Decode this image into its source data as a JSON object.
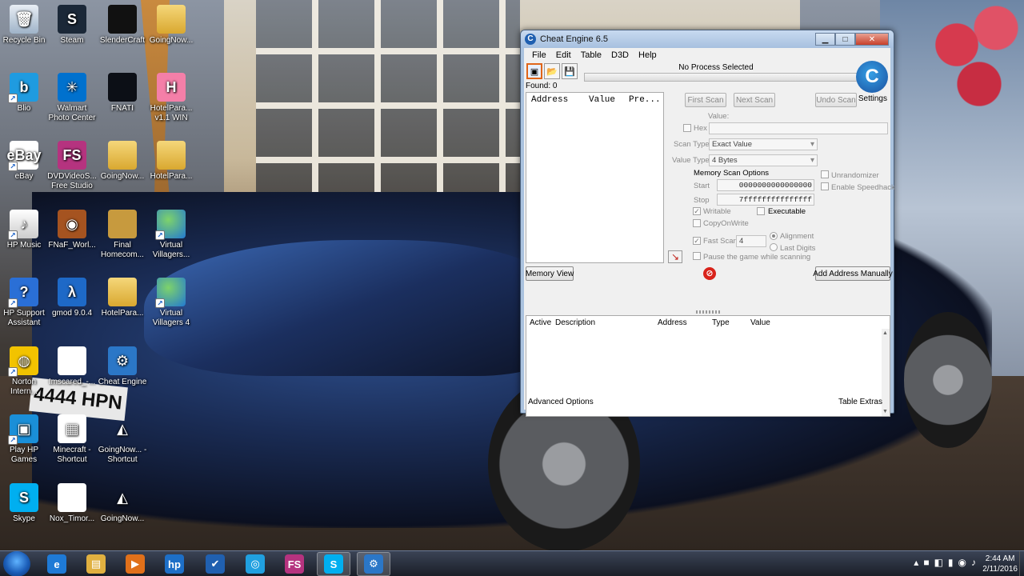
{
  "desktop": {
    "icons": [
      {
        "label": "Recycle Bin",
        "glyph": "🗑",
        "icon": "recycle-bin-icon"
      },
      {
        "label": "Steam",
        "glyph": "S",
        "icon": "steam-icon"
      },
      {
        "label": "SlenderCraft",
        "glyph": "",
        "icon": "slendercraft-icon"
      },
      {
        "label": "GoingNow...",
        "glyph": "",
        "icon": "folder-icon"
      },
      {
        "label": "Blio",
        "glyph": "b",
        "icon": "blio-icon"
      },
      {
        "label": "Walmart Photo Center",
        "glyph": "✳",
        "icon": "walmart-icon"
      },
      {
        "label": "FNATI",
        "glyph": "",
        "icon": "fnati-icon"
      },
      {
        "label": "HotelPara... v1.1 WIN",
        "glyph": "H",
        "icon": "hotel-icon"
      },
      {
        "label": "eBay",
        "glyph": "eBay",
        "icon": "ebay-icon"
      },
      {
        "label": "DVDVideoS... Free Studio",
        "glyph": "FS",
        "icon": "dvdvideosoft-icon"
      },
      {
        "label": "GoingNow...",
        "glyph": "",
        "icon": "folder-icon"
      },
      {
        "label": "HotelPara...",
        "glyph": "",
        "icon": "folder-icon"
      },
      {
        "label": "HP Music",
        "glyph": "♪",
        "icon": "hp-music-icon"
      },
      {
        "label": "FNaF_Worl...",
        "glyph": "◉",
        "icon": "fnaf-world-icon"
      },
      {
        "label": "Final Homecom...",
        "glyph": "",
        "icon": "final-homecoming-icon"
      },
      {
        "label": "Virtual Villagers...",
        "glyph": "",
        "icon": "globe-icon"
      },
      {
        "label": "HP Support Assistant",
        "glyph": "?",
        "icon": "hp-support-icon"
      },
      {
        "label": "gmod 9.0.4",
        "glyph": "λ",
        "icon": "gmod-icon"
      },
      {
        "label": "HotelPara...",
        "glyph": "",
        "icon": "folder-icon"
      },
      {
        "label": "Virtual Villagers 4",
        "glyph": "",
        "icon": "globe-icon"
      },
      {
        "label": "Norton Intern...",
        "glyph": "◍",
        "icon": "norton-icon"
      },
      {
        "label": "Imscared_-...",
        "glyph": "",
        "icon": "document-icon"
      },
      {
        "label": "Cheat Engine",
        "glyph": "⚙",
        "icon": "cheat-engine-icon"
      },
      {
        "label": "Play HP Games",
        "glyph": "▣",
        "icon": "play-hp-games-icon"
      },
      {
        "label": "Minecraft - Shortcut",
        "glyph": "▦",
        "icon": "minecraft-icon"
      },
      {
        "label": "GoingNow... - Shortcut",
        "glyph": "◭",
        "icon": "unity-icon"
      },
      {
        "label": "Skype",
        "glyph": "S",
        "icon": "skype-icon"
      },
      {
        "label": "Nox_Timor...",
        "glyph": "",
        "icon": "document-icon"
      },
      {
        "label": "GoingNow...",
        "glyph": "◭",
        "icon": "unity-icon"
      }
    ],
    "wallpaper_plate": "4444 HPN"
  },
  "ce": {
    "title": "Cheat Engine 6.5",
    "app_glyph": "C",
    "win_buttons": {
      "min": "▁",
      "max": "□",
      "close": "✕"
    },
    "menu": [
      "File",
      "Edit",
      "Table",
      "D3D",
      "Help"
    ],
    "toolbar_glyphs": {
      "process": "▣",
      "open": "📂",
      "save": "💾"
    },
    "process_label": "No Process Selected",
    "found": "Found: 0",
    "logo_glyph": "C",
    "settings": "Settings",
    "addr_headers": [
      "Address",
      "Value",
      "Pre..."
    ],
    "first_scan": "First Scan",
    "next_scan": "Next Scan",
    "undo_scan": "Undo Scan",
    "value_label": "Value:",
    "hex": "Hex",
    "scan_type_label": "Scan Type",
    "scan_type_value": "Exact Value",
    "value_type_label": "Value Type",
    "value_type_value": "4 Bytes",
    "mem_opts_label": "Memory Scan Options",
    "start_label": "Start",
    "start_value": "0000000000000000",
    "stop_label": "Stop",
    "stop_value": "7fffffffffffffff",
    "writable": "Writable",
    "executable": "Executable",
    "copyonwrite": "CopyOnWrite",
    "fast_scan": "Fast Scan",
    "fast_scan_value": "4",
    "alignment": "Alignment",
    "last_digits": "Last Digits",
    "pause_game": "Pause the game while scanning",
    "unrandomizer": "Unrandomizer",
    "enable_speedhack": "Enable Speedhack",
    "memory_view": "Memory View",
    "add_address": "Add Address Manually",
    "stop_glyph": "⊘",
    "pointer_glyph": "↘",
    "check_mark": "✓",
    "table_headers": [
      "Active",
      "Description",
      "Address",
      "Type",
      "Value"
    ],
    "scroll_up": "▲",
    "scroll_down": "▼",
    "advanced_options": "Advanced Options",
    "table_extras": "Table Extras"
  },
  "taskbar": {
    "apps": [
      {
        "glyph": "e",
        "icon": "internet-explorer-icon",
        "color": "#1e7ad6"
      },
      {
        "glyph": "▤",
        "icon": "file-explorer-icon",
        "color": "#e0b040"
      },
      {
        "glyph": "▶",
        "icon": "media-player-icon",
        "color": "#e0701a"
      },
      {
        "glyph": "hp",
        "icon": "hp-icon",
        "color": "#1d6fc7"
      },
      {
        "glyph": "✔",
        "icon": "task-icon",
        "color": "#2060b0"
      },
      {
        "glyph": "◎",
        "icon": "browser-icon",
        "color": "#20a0e0"
      },
      {
        "glyph": "FS",
        "icon": "dvdvideosoft-icon",
        "color": "#b5337f"
      },
      {
        "glyph": "S",
        "icon": "skype-icon",
        "color": "#00aff0"
      },
      {
        "glyph": "⚙",
        "icon": "cheat-engine-icon",
        "color": "#2b77c7"
      }
    ],
    "tray": [
      "▴",
      "■",
      "◧",
      "▮",
      "◉",
      "♪"
    ],
    "time": "2:44 AM",
    "date": "2/11/2016"
  }
}
